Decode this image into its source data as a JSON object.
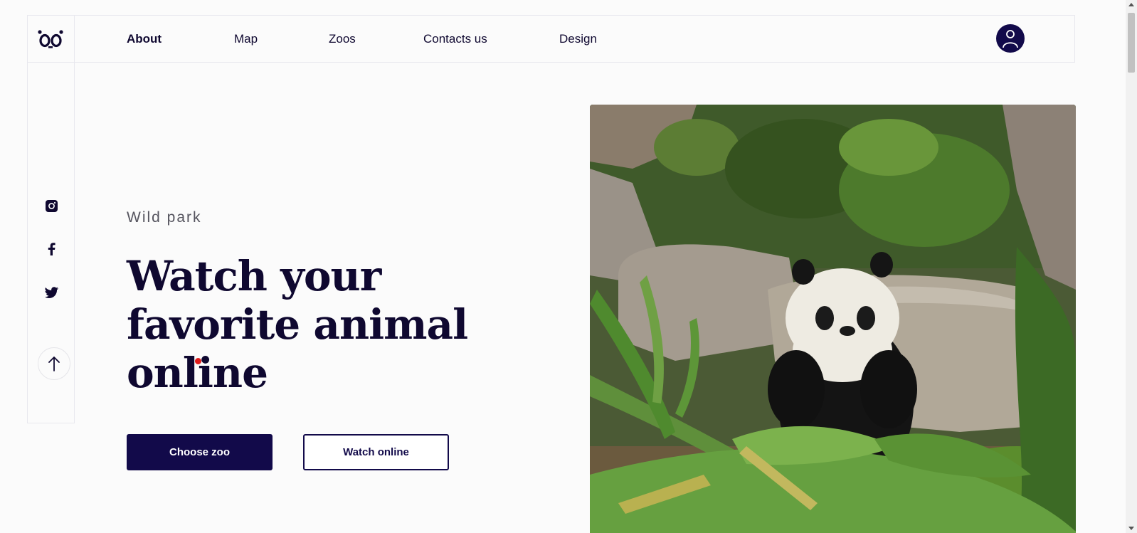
{
  "nav": {
    "items": [
      {
        "label": "About",
        "active": true
      },
      {
        "label": "Map",
        "active": false
      },
      {
        "label": "Zoos",
        "active": false
      },
      {
        "label": "Contacts us",
        "active": false
      },
      {
        "label": "Design",
        "active": false
      }
    ]
  },
  "logo": {
    "icon": "panda-face-logo"
  },
  "user": {
    "icon": "user-icon"
  },
  "social": [
    {
      "icon": "instagram-icon"
    },
    {
      "icon": "facebook-icon"
    },
    {
      "icon": "twitter-icon"
    }
  ],
  "scroll_top": {
    "icon": "arrow-up-icon"
  },
  "hero": {
    "eyebrow": "Wild park",
    "headline": "Watch your favorite animal online",
    "primary_button": "Choose zoo",
    "secondary_button": "Watch online",
    "image": "panda-eating-bamboo-photo"
  },
  "colors": {
    "brand": "#120a4a",
    "accent_dot": "#e01b1b",
    "background": "#fbfbfb"
  }
}
